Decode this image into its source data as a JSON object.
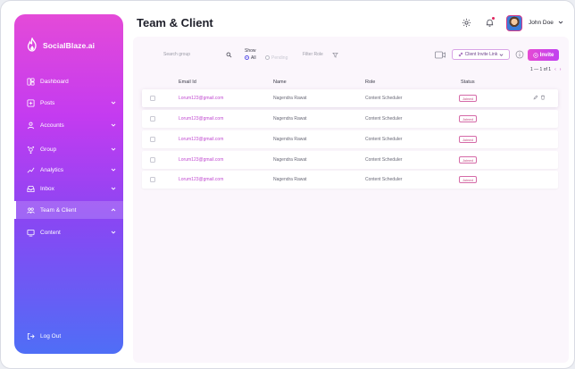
{
  "brand": {
    "name": "SocialBlaze.ai"
  },
  "sidebar": {
    "items": [
      {
        "label": "Dashboard",
        "icon": "dashboard-icon",
        "has_chevron": false
      },
      {
        "label": "Posts",
        "icon": "posts-icon",
        "has_chevron": true
      },
      {
        "label": "Accounts",
        "icon": "accounts-icon",
        "has_chevron": true
      },
      {
        "label": "Group",
        "icon": "group-icon",
        "has_chevron": true
      },
      {
        "label": "Analytics",
        "icon": "analytics-icon",
        "has_chevron": true
      },
      {
        "label": "Inbox",
        "icon": "inbox-icon",
        "has_chevron": true
      },
      {
        "label": "Team & Client",
        "icon": "team-icon",
        "has_chevron": true,
        "active": true
      },
      {
        "label": "Content",
        "icon": "content-icon",
        "has_chevron": true
      }
    ],
    "logout_label": "Log Out"
  },
  "header": {
    "title": "Team & Client",
    "user_name": "John Doe"
  },
  "toolbar": {
    "search_placeholder": "Search group",
    "show_label": "Show",
    "show_options": [
      "All",
      "Pending"
    ],
    "show_selected": "All",
    "filter_placeholder": "Filter Role",
    "invite_link_label": "Client Invite Link",
    "invite_label": "Invite"
  },
  "pagination": {
    "text": "1 — 1 of 1"
  },
  "table": {
    "columns": [
      "Email Id",
      "Name",
      "Role",
      "Status"
    ],
    "rows": [
      {
        "email": "Lorum123@gmail.com",
        "name": "Nagendra Rawat",
        "role": "Content Scheduler",
        "status": "Joined"
      },
      {
        "email": "Lorum123@gmail.com",
        "name": "Nagendra Rawat",
        "role": "Content Scheduler",
        "status": "Joined"
      },
      {
        "email": "Lorum123@gmail.com",
        "name": "Nagendra Rawat",
        "role": "Content Scheduler",
        "status": "Joined"
      },
      {
        "email": "Lorum123@gmail.com",
        "name": "Nagendra Rawat",
        "role": "Content Scheduler",
        "status": "Joined"
      },
      {
        "email": "Lorum123@gmail.com",
        "name": "Nagendra Rawat",
        "role": "Content Scheduler",
        "status": "Joined"
      }
    ]
  },
  "colors": {
    "accent": "#c040f0",
    "accent_pink": "#e64ad4",
    "status_joined": "#c0407a"
  }
}
